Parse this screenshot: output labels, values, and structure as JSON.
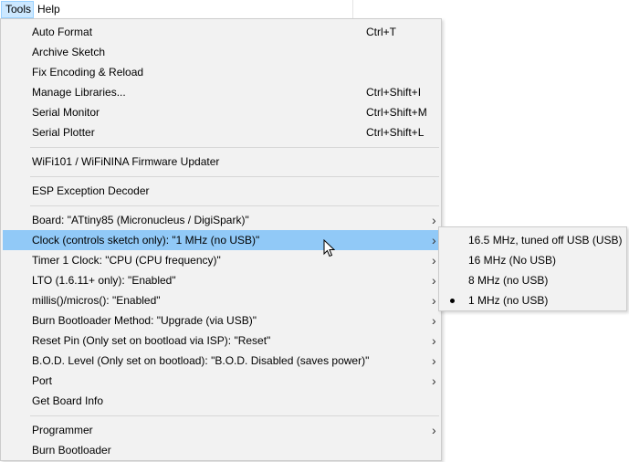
{
  "menubar": {
    "tools": "Tools",
    "help": "Help"
  },
  "tools_menu": {
    "groups": [
      [
        {
          "label": "Auto Format",
          "shortcut": "Ctrl+T"
        },
        {
          "label": "Archive Sketch",
          "shortcut": ""
        },
        {
          "label": "Fix Encoding & Reload",
          "shortcut": ""
        },
        {
          "label": "Manage Libraries...",
          "shortcut": "Ctrl+Shift+I"
        },
        {
          "label": "Serial Monitor",
          "shortcut": "Ctrl+Shift+M"
        },
        {
          "label": "Serial Plotter",
          "shortcut": "Ctrl+Shift+L"
        }
      ],
      [
        {
          "label": "WiFi101 / WiFiNINA Firmware Updater",
          "shortcut": ""
        }
      ],
      [
        {
          "label": "ESP Exception Decoder",
          "shortcut": ""
        }
      ],
      [
        {
          "label": "Board: \"ATtiny85 (Micronucleus / DigiSpark)\"",
          "submenu": true
        },
        {
          "label": "Clock (controls sketch only): \"1 MHz (no USB)\"",
          "submenu": true,
          "highlighted": true
        },
        {
          "label": "Timer 1 Clock: \"CPU (CPU frequency)\"",
          "submenu": true
        },
        {
          "label": "LTO (1.6.11+ only): \"Enabled\"",
          "submenu": true
        },
        {
          "label": "millis()/micros(): \"Enabled\"",
          "submenu": true
        },
        {
          "label": "Burn Bootloader Method: \"Upgrade (via USB)\"",
          "submenu": true
        },
        {
          "label": "Reset Pin (Only set on bootload via ISP): \"Reset\"",
          "submenu": true
        },
        {
          "label": "B.O.D. Level (Only set on bootload): \"B.O.D. Disabled (saves power)\"",
          "submenu": true
        },
        {
          "label": "Port",
          "submenu": true
        },
        {
          "label": "Get Board Info",
          "submenu": false
        }
      ],
      [
        {
          "label": "Programmer",
          "submenu": true
        },
        {
          "label": "Burn Bootloader",
          "submenu": false
        }
      ]
    ]
  },
  "clock_submenu": {
    "options": [
      {
        "label": "16.5 MHz, tuned off USB (USB)",
        "selected": false
      },
      {
        "label": "16 MHz (No USB)",
        "selected": false
      },
      {
        "label": "8 MHz (no USB)",
        "selected": false
      },
      {
        "label": "1 MHz (no USB)",
        "selected": true
      }
    ]
  },
  "icons": {
    "submenu_arrow": "chevron-right-icon",
    "radio_selected": "radio-dot-icon",
    "cursor": "mouse-cursor-icon"
  },
  "colors": {
    "highlight": "#91c9f7",
    "menu_bg": "#f2f2f2",
    "menubar_open": "#cce8ff"
  }
}
